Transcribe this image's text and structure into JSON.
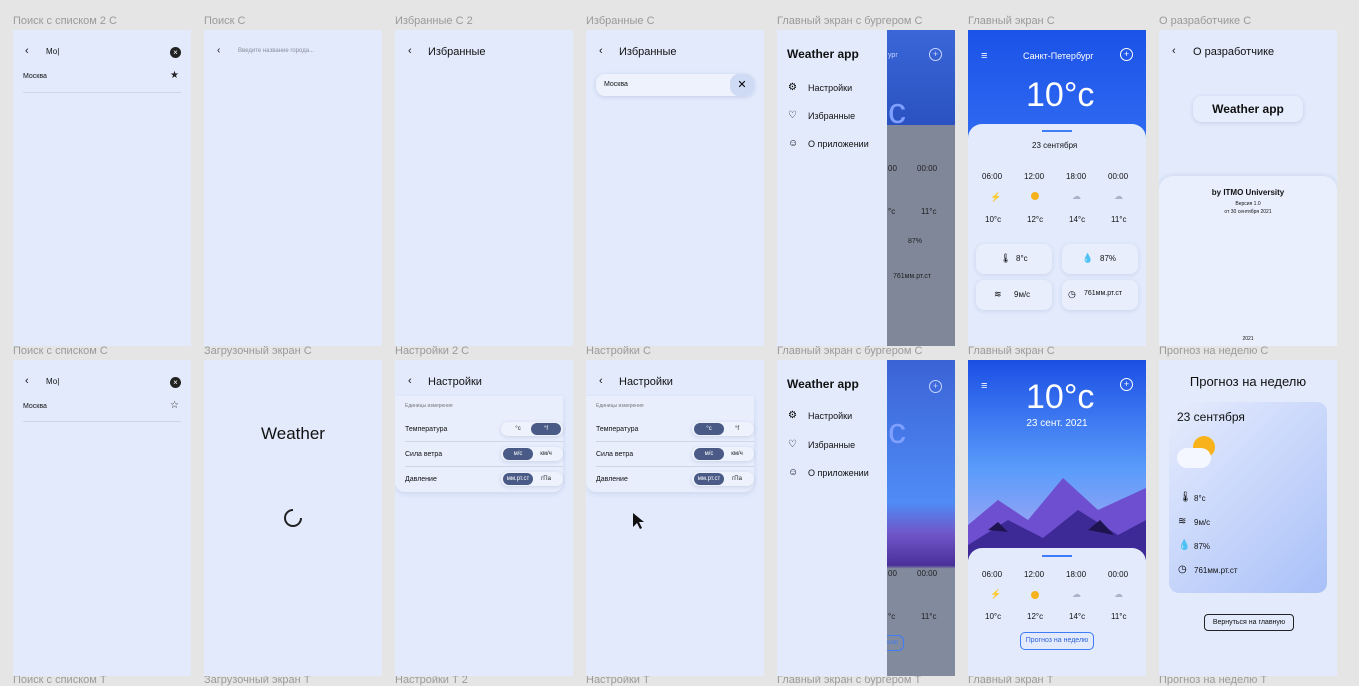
{
  "labels_top": [
    "Поиск с списком 2 С",
    "Поиск С",
    "Избранные С 2",
    "Избранные С",
    "Главный экран с бургером С",
    "Главный экран С",
    "О разработчике С"
  ],
  "labels_mid": [
    "Поиск с списком С",
    "Загрузочный экран С",
    "Настройки 2 С",
    "Настройки С",
    "Главный экран с бургером С",
    "Главный экран С",
    "Прогноз на неделю С"
  ],
  "labels_bot": [
    "Поиск с списком Т",
    "Загрузочный экран Т",
    "Настройки Т 2",
    "Настройки Т",
    "Главный экран с бургером Т",
    "Главный экран Т",
    "Прогноз на неделю Т"
  ],
  "search": {
    "query": "Мо|",
    "result": "Москва",
    "placeholder": "Введите название города..."
  },
  "favorites": {
    "title": "Избранные",
    "item": "Москва"
  },
  "menu": {
    "app": "Weather app",
    "items": [
      "Настройки",
      "Избранные",
      "О приложении"
    ],
    "peek_city": "ург",
    "times": [
      "00",
      "00:00"
    ],
    "temps": [
      "°c",
      "11°c"
    ],
    "hum": "87%",
    "press": "761мм.рт.ст",
    "btn": "елю"
  },
  "main": {
    "city": "Санкт-Петербург",
    "temp": "10°c",
    "date": "23 сентября",
    "date2": "23 сент. 2021",
    "hours": [
      "06:00",
      "12:00",
      "18:00",
      "00:00"
    ],
    "temps": [
      "10°c",
      "12°c",
      "14°c",
      "11°c"
    ],
    "feels": "8°c",
    "humidity": "87%",
    "wind": "9м/с",
    "pressure": "761мм.рт.ст",
    "week_btn": "Прогноз на неделю"
  },
  "about": {
    "title": "О разработчике",
    "app": "Weather app",
    "by": "by ITMO University",
    "version": "Версия 1.0",
    "date": "от 30 сентября 2021",
    "year": "2021"
  },
  "loading": {
    "title": "Weather"
  },
  "settings": {
    "title": "Настройки",
    "caption": "Единицы измерения",
    "rows": [
      "Температура",
      "Сила ветра",
      "Давление"
    ],
    "temp_opts": [
      "°c",
      "°f"
    ],
    "wind_opts": [
      "м/с",
      "км/ч"
    ],
    "press_opts": [
      "мм.рт.ст",
      "гПа"
    ]
  },
  "week": {
    "title": "Прогноз на неделю",
    "date": "23 сентября",
    "feels": "8°c",
    "wind": "9м/с",
    "humidity": "87%",
    "pressure": "761мм.рт.ст",
    "back_btn": "Вернуться на главную"
  }
}
